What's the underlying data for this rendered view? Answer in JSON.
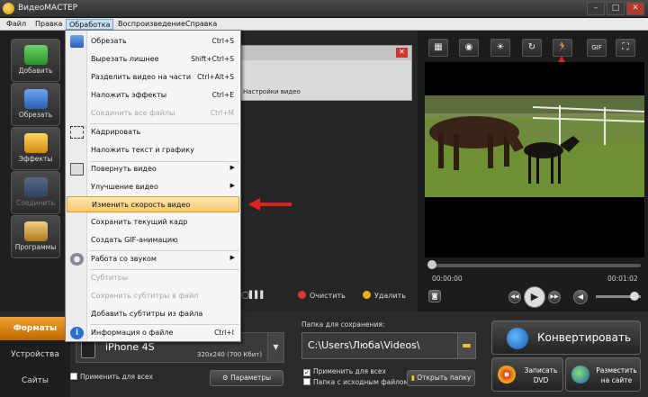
{
  "window": {
    "title": "ВидеоМАСТЕР"
  },
  "menubar": [
    "Файл",
    "Правка",
    "Обработка",
    "Воспроизведение",
    "Справка"
  ],
  "left_buttons": [
    {
      "label": "Добавить",
      "icon": "add-icon",
      "color": "#3fae3a"
    },
    {
      "label": "Обрезать",
      "icon": "cut-icon",
      "color": "#3a7bd5"
    },
    {
      "label": "Эффекты",
      "icon": "effects-icon",
      "color": "#e0a020"
    },
    {
      "label": "Соединить",
      "icon": "join-icon",
      "color": "#3a6aa8"
    },
    {
      "label": "Программы",
      "icon": "programs-icon",
      "color": "#d0a030"
    }
  ],
  "dropdown": [
    {
      "label": "Обрезать",
      "shortcut": "Ctrl+S",
      "icon": "trim-icon"
    },
    {
      "label": "Вырезать лишнее",
      "shortcut": "Shift+Ctrl+S"
    },
    {
      "label": "Разделить видео на части",
      "shortcut": "Ctrl+Alt+S"
    },
    {
      "label": "Наложить эффекты",
      "shortcut": "Ctrl+E"
    },
    {
      "label": "Соединить все файлы",
      "shortcut": "Ctrl+M",
      "disabled": true
    },
    {
      "label": "Кадрировать",
      "icon": "crop-icon"
    },
    {
      "label": "Наложить текст и графику"
    },
    {
      "label": "Повернуть видео",
      "submenu": true,
      "icon": "rotate-icon"
    },
    {
      "label": "Улучшение видео",
      "submenu": true
    },
    {
      "label": "Изменить скорость видео",
      "highlighted": true
    },
    {
      "label": "Сохранить текущий кадр"
    },
    {
      "label": "Создать GIF-анимацию"
    },
    {
      "label": "Работа со звуком",
      "submenu": true,
      "icon": "sound-icon"
    },
    {
      "label": "Субтитры",
      "disabled": true
    },
    {
      "label": "Сохранить субтитры в файл",
      "disabled": true
    },
    {
      "label": "Добавить субтитры из файла"
    },
    {
      "label": "Информация о файле",
      "shortcut": "Ctrl+I",
      "icon": "info-icon"
    }
  ],
  "clip": {
    "settings_label": "Настройки видео"
  },
  "list_actions": {
    "clear": "Очистить",
    "delete": "Удалить"
  },
  "player": {
    "time_current": "00:00:00",
    "time_total": "00:01:02",
    "progress": 0.0,
    "volume": 0.75
  },
  "tabs": [
    "Форматы",
    "Устройства",
    "Сайты"
  ],
  "device": {
    "name": "iPhone 4S",
    "spec": "320x240 (700 Кбит)",
    "apply_all": "Применить для всех",
    "params_button": "Параметры"
  },
  "save": {
    "label": "Папка для сохранения:",
    "path": "C:\\Users\\Люба\\Videos\\",
    "apply_all": "Применить для всех",
    "source_folder": "Папка с исходным файлом",
    "open_folder": "Открыть папку"
  },
  "actions": {
    "convert": "Конвертировать",
    "burn": "Записать DVD",
    "publish": "Разместить на сайте"
  }
}
